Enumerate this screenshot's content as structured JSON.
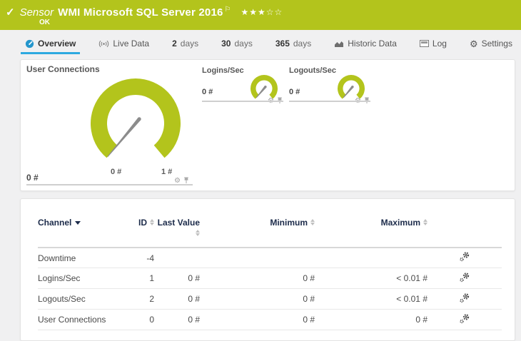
{
  "header": {
    "check_icon": "✓",
    "kind": "Sensor",
    "title": "WMI Microsoft SQL Server 2016",
    "flag": "⚐",
    "stars": "★★★☆☆",
    "status": "OK",
    "bar_color": "#b3c41c"
  },
  "tabs": {
    "overview": "Overview",
    "live_data": "Live Data",
    "days2_num": "2",
    "days2_unit": "days",
    "days30_num": "30",
    "days30_unit": "days",
    "days365_num": "365",
    "days365_unit": "days",
    "historic": "Historic Data",
    "log": "Log",
    "settings": "Settings",
    "active_tab": "Overview",
    "active_underline_color": "#2da9e0"
  },
  "gauges": {
    "accent_color": "#b3c41c",
    "needle_color": "#8c8c8c",
    "primary": {
      "title": "User Connections",
      "value": "0 #",
      "scale_min": "0 #",
      "scale_max": "1 #"
    },
    "logins": {
      "title": "Logins/Sec",
      "value": "0 #"
    },
    "logouts": {
      "title": "Logouts/Sec",
      "value": "0 #"
    }
  },
  "table": {
    "columns": {
      "channel": "Channel",
      "id": "ID",
      "last_value": "Last Value",
      "minimum": "Minimum",
      "maximum": "Maximum"
    },
    "rows": [
      {
        "channel": "Downtime",
        "id": "-4",
        "last": "",
        "min": "",
        "max": ""
      },
      {
        "channel": "Logins/Sec",
        "id": "1",
        "last": "0 #",
        "min": "0 #",
        "max": "< 0.01 #"
      },
      {
        "channel": "Logouts/Sec",
        "id": "2",
        "last": "0 #",
        "min": "0 #",
        "max": "< 0.01 #"
      },
      {
        "channel": "User Connections",
        "id": "0",
        "last": "0 #",
        "min": "0 #",
        "max": "0 #"
      }
    ]
  }
}
